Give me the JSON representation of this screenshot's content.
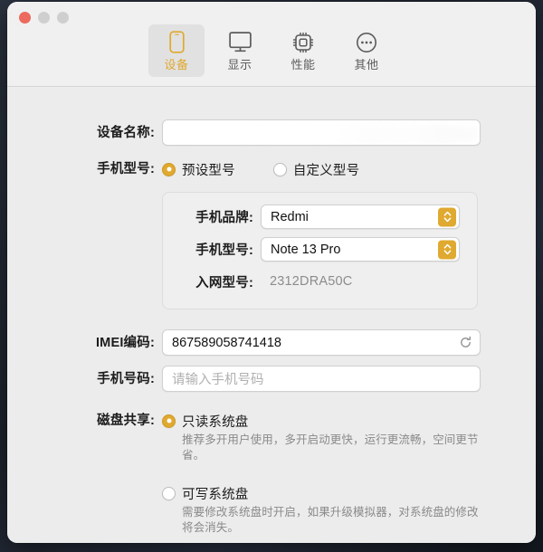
{
  "window": {
    "traffic_lights": [
      "close",
      "minimize",
      "zoom"
    ]
  },
  "toolbar": {
    "tabs": [
      {
        "label": "设备",
        "icon": "phone-icon",
        "active": true
      },
      {
        "label": "显示",
        "icon": "monitor-icon",
        "active": false
      },
      {
        "label": "性能",
        "icon": "cpu-icon",
        "active": false
      },
      {
        "label": "其他",
        "icon": "ellipsis-circle-icon",
        "active": false
      }
    ]
  },
  "form": {
    "device_name": {
      "label": "设备名称:",
      "value": "",
      "redacted": true
    },
    "phone_model": {
      "label": "手机型号:",
      "options": [
        {
          "label": "预设型号",
          "selected": true
        },
        {
          "label": "自定义型号",
          "selected": false
        }
      ]
    },
    "preset_group": {
      "brand": {
        "label": "手机品牌:",
        "value": "Redmi"
      },
      "model": {
        "label": "手机型号:",
        "value": "Note 13 Pro"
      },
      "network_model": {
        "label": "入网型号:",
        "value": "2312DRA50C"
      }
    },
    "imei": {
      "label": "IMEI编码:",
      "value": "867589058741418",
      "refresh_icon": "refresh-icon"
    },
    "phone_number": {
      "label": "手机号码:",
      "value": "",
      "placeholder": "请输入手机号码"
    },
    "disk_share": {
      "label": "磁盘共享:",
      "options": [
        {
          "title": "只读系统盘",
          "description": "推荐多开用户使用，多开启动更快，运行更流畅，空间更节省。",
          "selected": true
        },
        {
          "title": "可写系统盘",
          "description": "需要修改系统盘时开启，如果升级模拟器，对系统盘的修改将会消失。",
          "selected": false
        }
      ]
    }
  },
  "colors": {
    "accent": "#e0a92f",
    "window_bg": "#ececec",
    "toolbar_bg": "#f0f0f0",
    "close_light": "#ec6a5e",
    "inactive_light": "#cfcfcf",
    "muted_text": "#8a8a8a"
  }
}
